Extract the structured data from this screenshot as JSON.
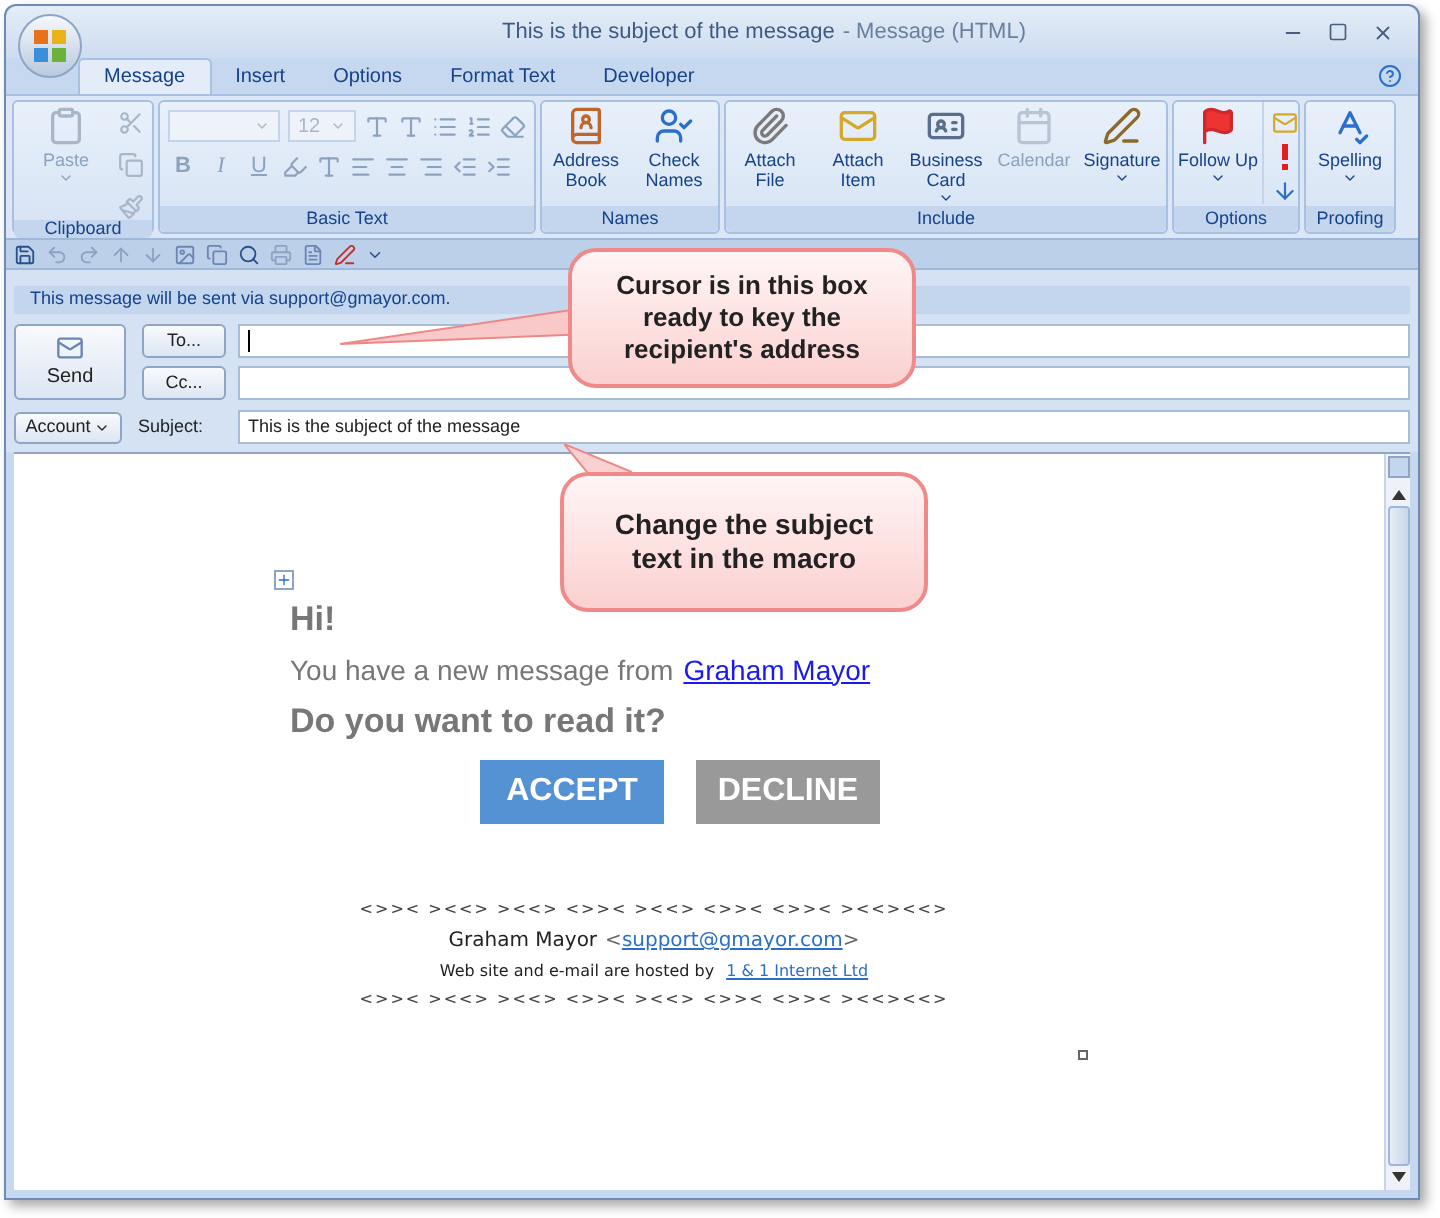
{
  "window": {
    "title": "This is the subject of the message",
    "app": "- Message (HTML)"
  },
  "tabs": [
    {
      "label": "Message",
      "selected": true
    },
    {
      "label": "Insert",
      "selected": false
    },
    {
      "label": "Options",
      "selected": false
    },
    {
      "label": "Format Text",
      "selected": false
    },
    {
      "label": "Developer",
      "selected": false
    }
  ],
  "ribbon": {
    "groups": [
      {
        "kind": "clipboard",
        "label": "Clipboard",
        "items": [
          {
            "label": "Paste",
            "disabled": true,
            "dropdown": true
          }
        ]
      },
      {
        "kind": "basic_text",
        "label": "Basic Text",
        "font_size": "12",
        "format_buttons": [
          "B",
          "I",
          "U"
        ]
      },
      {
        "kind": "names",
        "label": "Names",
        "items": [
          {
            "label": "Address Book",
            "disabled": false,
            "dropdown": false
          },
          {
            "label": "Check Names",
            "disabled": false,
            "dropdown": false
          }
        ]
      },
      {
        "kind": "include",
        "label": "Include",
        "items": [
          {
            "label": "Attach File",
            "disabled": false,
            "dropdown": false
          },
          {
            "label": "Attach Item",
            "disabled": false,
            "dropdown": false
          },
          {
            "label": "Business Card",
            "disabled": false,
            "dropdown": true
          },
          {
            "label": "Calendar",
            "disabled": true,
            "dropdown": false
          },
          {
            "label": "Signature",
            "disabled": false,
            "dropdown": true
          }
        ]
      },
      {
        "kind": "options",
        "label": "Options",
        "items": [
          {
            "label": "Follow Up",
            "disabled": false,
            "dropdown": true
          }
        ]
      },
      {
        "kind": "proofing",
        "label": "Proofing",
        "items": [
          {
            "label": "Spelling",
            "disabled": false,
            "dropdown": true
          }
        ]
      }
    ]
  },
  "info_bar": "This message will be sent via support@gmayor.com.",
  "header": {
    "send": "Send",
    "to": {
      "button": "To..."
    },
    "cc": {
      "button": "Cc..."
    },
    "account": "Account",
    "subject_label": "Subject:",
    "subject": "This is the subject of the message"
  },
  "body": {
    "greeting": "Hi!",
    "line": "You have a new message from",
    "sender_link": "Graham Mayor",
    "question": "Do you want to read it?",
    "buttons": [
      {
        "label": "ACCEPT",
        "color": "#5592d4"
      },
      {
        "label": "DECLINE",
        "color": "#999999"
      }
    ],
    "signature": {
      "rule_top": "<>>< ><<> ><<> <>>< ><<> <>>< <>>< ><<><<>",
      "name": "Graham Mayor",
      "open_bracket": "<",
      "email": "support@gmayor.com",
      "close_bracket": ">",
      "hosted": "Web site and e-mail are hosted by",
      "host_link": "1 & 1 Internet Ltd",
      "rule_bottom": "<>>< ><<> ><<> <>>< ><<> <>>< <>>< ><<><<>"
    }
  },
  "callouts": [
    {
      "text": "Cursor is in this box ready to key the recipient's address"
    },
    {
      "text": "Change the subject text in the macro"
    }
  ]
}
